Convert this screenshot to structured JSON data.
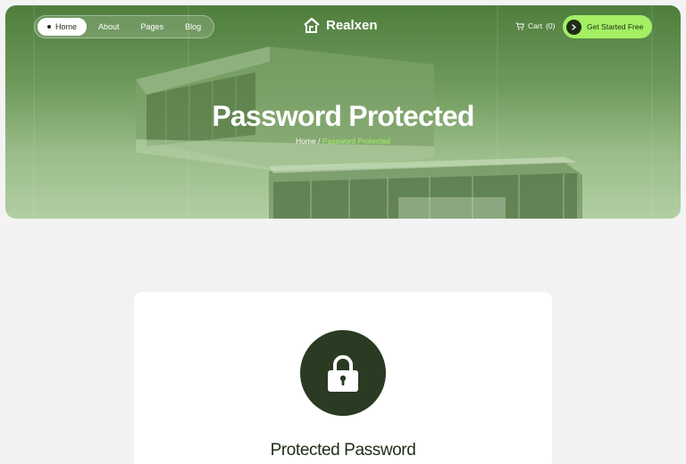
{
  "nav": {
    "items": [
      {
        "label": "Home",
        "active": true
      },
      {
        "label": "About",
        "active": false
      },
      {
        "label": "Pages",
        "active": false
      },
      {
        "label": "Blog",
        "active": false
      }
    ]
  },
  "brand": {
    "name": "Realxen",
    "icon": "house-logo-icon"
  },
  "header": {
    "cart_label": "Cart",
    "cart_count": "(0)",
    "cta_label": "Get Started Free"
  },
  "hero": {
    "title": "Password Protected",
    "breadcrumb_home": "Home",
    "breadcrumb_separator": " / ",
    "breadcrumb_current": "Password Protected"
  },
  "card": {
    "title": "Protected Password",
    "icon": "lock-icon"
  },
  "colors": {
    "accent": "#a4ef64",
    "dark": "#1f2d17",
    "lock_bg": "#2b3a22"
  }
}
